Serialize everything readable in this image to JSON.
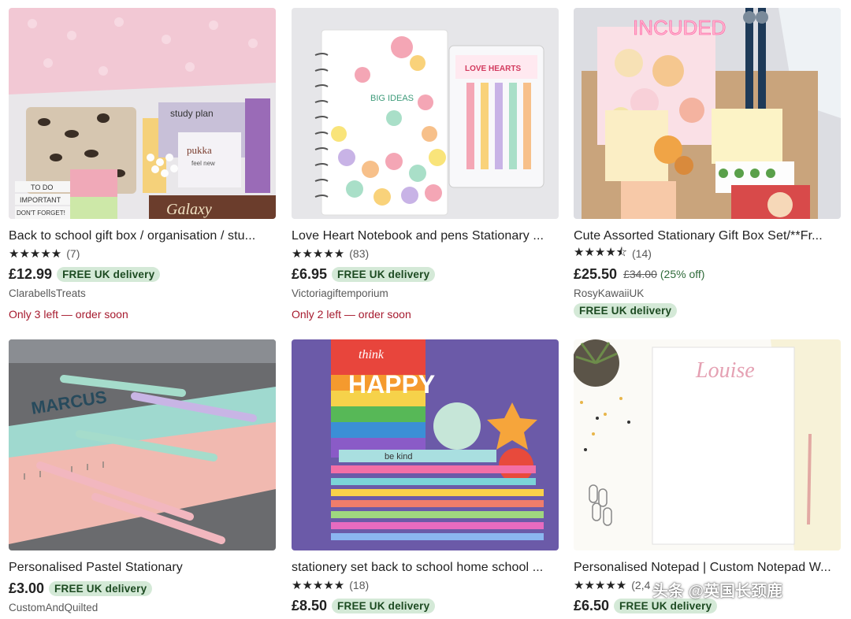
{
  "listings": [
    {
      "title": "Back to school gift box / organisation / stu...",
      "stars": "★★★★★",
      "reviews": "(7)",
      "price": "£12.99",
      "delivery": "FREE UK delivery",
      "shop": "ClarabellsTreats",
      "urgency": "Only 3 left — order soon",
      "image_text": [
        "study plan",
        "TO DO",
        "IMPORTANT",
        "DON'T FORGET!",
        "Galaxy",
        "pukka",
        "feel new"
      ]
    },
    {
      "title": "Love Heart Notebook and pens Stationary ...",
      "stars": "★★★★★",
      "reviews": "(83)",
      "price": "£6.95",
      "delivery": "FREE UK delivery",
      "shop": "Victoriagiftemporium",
      "urgency": "Only 2 left — order soon",
      "image_text": [
        "BIG IDEAS",
        "LOVE HEARTS"
      ]
    },
    {
      "title": "Cute Assorted Stationary Gift Box Set/**Fr...",
      "stars": "★★★★⯪",
      "reviews": "(14)",
      "price": "£25.50",
      "old_price": "£34.00",
      "discount": "(25% off)",
      "shop": "RosyKawaiiUK",
      "delivery": "FREE UK delivery",
      "image_text": [
        "INCUDED"
      ]
    },
    {
      "title": "Personalised Pastel Stationary",
      "price": "£3.00",
      "delivery": "FREE UK delivery",
      "shop": "CustomAndQuilted",
      "image_text": [
        "MARCUS"
      ]
    },
    {
      "title": "stationery set back to school home school ...",
      "stars": "★★★★★",
      "reviews": "(18)",
      "price": "£8.50",
      "delivery": "FREE UK delivery",
      "image_text": [
        "think",
        "HAPPY",
        "be kind"
      ]
    },
    {
      "title": "Personalised Notepad | Custom Notepad W...",
      "stars": "★★★★★",
      "reviews": "(2,4",
      "price": "£6.50",
      "delivery": "FREE UK delivery",
      "image_text": [
        "Louise"
      ]
    }
  ],
  "watermark": "头条 @英国长颈鹿",
  "colors": {
    "badge_bg": "#d4e9d7",
    "badge_text": "#1c4a21",
    "urgent": "#a61a2e",
    "discount": "#2f6b3a"
  }
}
